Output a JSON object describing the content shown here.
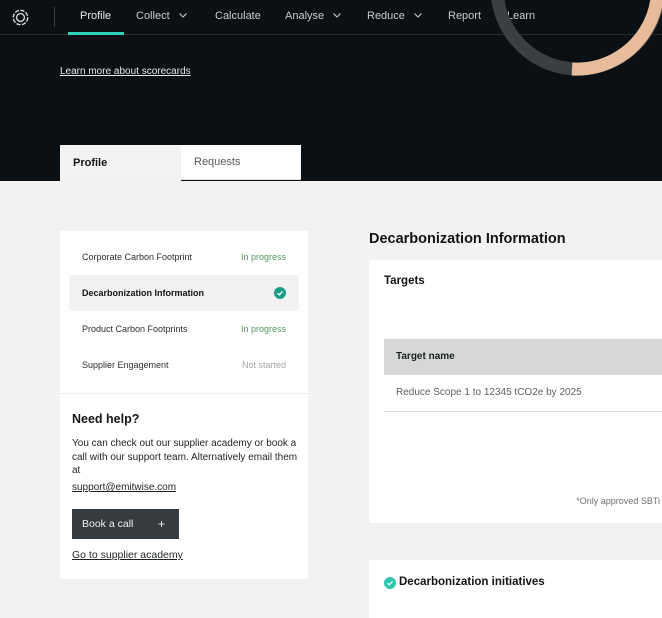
{
  "nav": {
    "logo": "emitwise-logo-icon",
    "items": [
      {
        "label": "Profile",
        "has_dropdown": false,
        "active": true
      },
      {
        "label": "Collect",
        "has_dropdown": true,
        "active": false
      },
      {
        "label": "Calculate",
        "has_dropdown": false,
        "active": false
      },
      {
        "label": "Analyse",
        "has_dropdown": true,
        "active": false
      },
      {
        "label": "Reduce",
        "has_dropdown": true,
        "active": false
      },
      {
        "label": "Report",
        "has_dropdown": false,
        "active": false
      },
      {
        "label": "Learn",
        "has_dropdown": false,
        "active": false
      }
    ]
  },
  "hero": {
    "learn_more_link": "Learn more about scorecards",
    "donut_colors": {
      "track": "#3a3f42",
      "progress": "#e8bc9b"
    }
  },
  "tabs": [
    {
      "label": "Profile",
      "active": true
    },
    {
      "label": "Requests",
      "active": false
    }
  ],
  "steps": [
    {
      "label": "Corporate Carbon Footprint",
      "status": "In progress",
      "status_type": "in-progress"
    },
    {
      "label": "Decarbonization Information",
      "status": "Completed",
      "status_type": "completed",
      "active": true
    },
    {
      "label": "Product Carbon Footprints",
      "status": "In progress",
      "status_type": "in-progress"
    },
    {
      "label": "Supplier Engagement",
      "status": "Not started",
      "status_type": "not-started"
    }
  ],
  "help": {
    "title": "Need help?",
    "text": "You can check out our supplier academy or book a call with our support team. Alternatively email them at",
    "email": "support@emitwise.com",
    "book_button": "Book a call",
    "book_button_icon": "+",
    "academy_link": "Go to supplier academy"
  },
  "main": {
    "title": "Decarbonization Information",
    "targets": {
      "title": "Targets",
      "columns": [
        "Target name"
      ],
      "rows": [
        [
          "Reduce Scope 1 to 12345 tCO2e by 2025"
        ]
      ],
      "footnote": "*Only approved SBTi"
    },
    "initiatives": {
      "title": "Decarbonization initiatives",
      "completed": true
    }
  },
  "colors": {
    "accent": "#2fd0b8",
    "check": "#1a9e84",
    "in_progress": "#4e9a5a",
    "not_started": "#a3a7aa",
    "hero_bg": "#0a1014"
  }
}
